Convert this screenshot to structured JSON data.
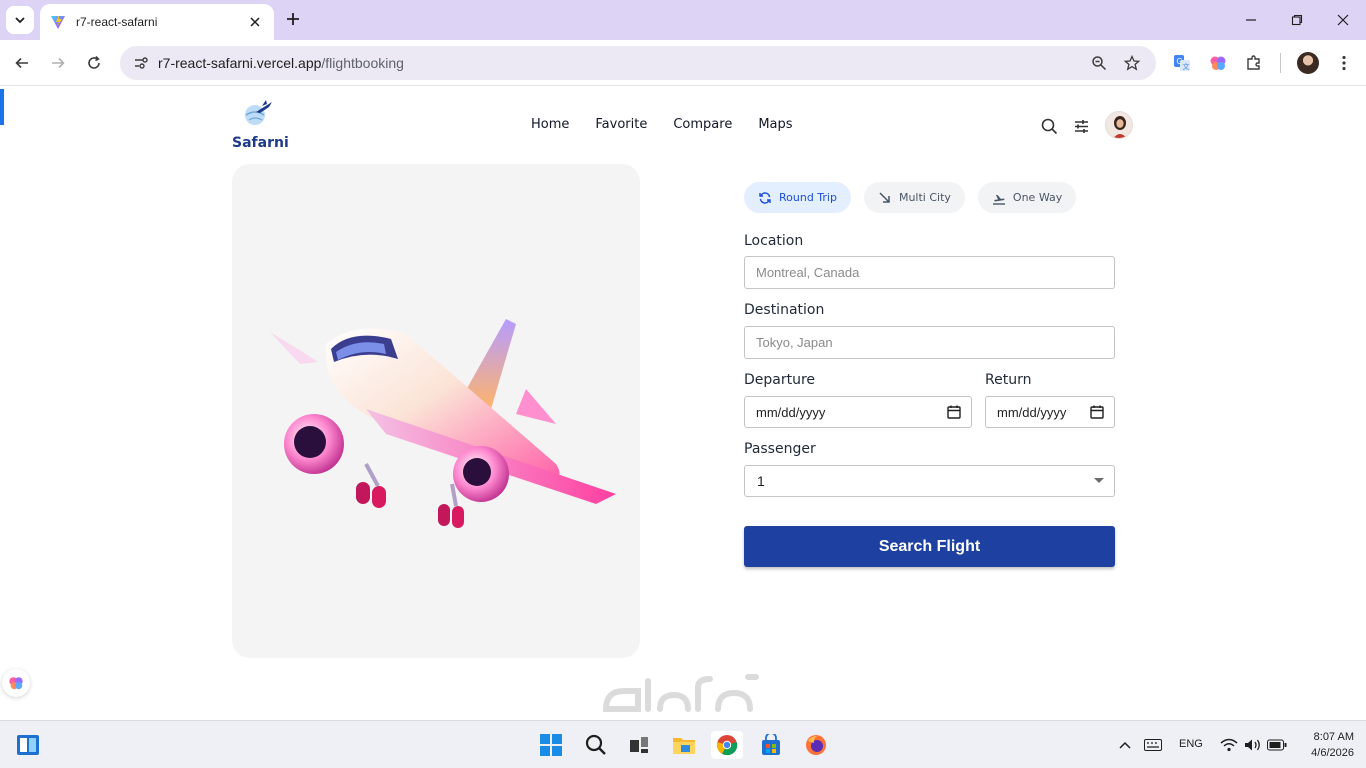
{
  "browser": {
    "tab": {
      "title": "r7-react-safarni"
    },
    "omnibox": {
      "host": "r7-react-safarni.vercel.app",
      "path": "/flightbooking"
    }
  },
  "site": {
    "logo_text": "Safarni",
    "nav": [
      "Home",
      "Favorite",
      "Compare",
      "Maps"
    ],
    "icons": [
      "search-icon",
      "filter-sliders-icon",
      "avatar"
    ]
  },
  "booking": {
    "trip_types": [
      {
        "label": "Round Trip",
        "icon": "round-trip-icon",
        "active": true
      },
      {
        "label": "Multi City",
        "icon": "multi-city-icon",
        "active": false
      },
      {
        "label": "One Way",
        "icon": "one-way-icon",
        "active": false
      }
    ],
    "location": {
      "label": "Location",
      "placeholder": "Montreal, Canada"
    },
    "destination": {
      "label": "Destination",
      "placeholder": "Tokyo, Japan"
    },
    "departure": {
      "label": "Departure",
      "value": "mm/dd/yyyy"
    },
    "return": {
      "label": "Return",
      "value": "mm/dd/yyyy"
    },
    "passenger": {
      "label": "Passenger",
      "value": "1"
    },
    "search_label": "Search Flight"
  },
  "taskbar": {
    "language": "ENG",
    "time": "8:07 AM",
    "date": "4/6/2026"
  },
  "colors": {
    "accent": "#1e40a0",
    "brand_text": "#1e3a8a",
    "tab_strip": "#dcd3f5",
    "active_pill": "#e3efff"
  }
}
